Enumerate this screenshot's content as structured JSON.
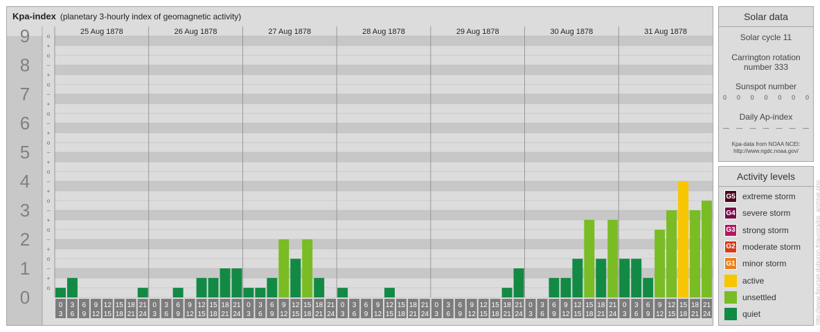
{
  "header": {
    "title": "Kpa-index",
    "subtitle": "(planetary 3-hourly index of geomagnetic activity)"
  },
  "chart_data": {
    "type": "bar",
    "ylim": [
      0,
      9
    ],
    "y_tick_labels": [
      "0",
      "1",
      "2",
      "3",
      "4",
      "5",
      "6",
      "7",
      "8",
      "9"
    ],
    "sub_labels": [
      "–",
      "o",
      "+"
    ],
    "days": [
      "25 Aug 1878",
      "26 Aug 1878",
      "27 Aug 1878",
      "28 Aug 1878",
      "29 Aug 1878",
      "30 Aug 1878",
      "31 Aug 1878"
    ],
    "interval_start": [
      "0",
      "3",
      "6",
      "9",
      "12",
      "15",
      "18",
      "21"
    ],
    "interval_end": [
      "3",
      "6",
      "9",
      "12",
      "15",
      "18",
      "21",
      "24"
    ],
    "values": [
      0.33,
      0.67,
      0,
      0,
      0,
      0,
      0,
      0.33,
      0,
      0,
      0.33,
      0,
      0.67,
      0.67,
      1,
      1,
      0.33,
      0.33,
      0.67,
      2,
      1.33,
      2,
      0.67,
      0,
      0.33,
      0,
      0,
      0,
      0.33,
      0,
      0,
      0,
      0,
      0,
      0,
      0,
      0,
      0,
      0.33,
      1,
      0,
      0,
      0.67,
      0.67,
      1.33,
      2.67,
      1.33,
      2.67,
      1.33,
      1.33,
      0.67,
      2.33,
      3,
      4,
      3,
      3.33
    ],
    "level_colors": {
      "quiet": "#128a44",
      "unsettled": "#79bc24",
      "active": "#f8c600"
    }
  },
  "solar": {
    "title": "Solar data",
    "cycle": "Solar cycle 11",
    "carrington_line1": "Carrington rotation",
    "carrington_line2": "number 333",
    "sunspot_label": "Sunspot number",
    "sunspot_values": [
      "0",
      "0",
      "0",
      "0",
      "0",
      "0",
      "0"
    ],
    "ap_label": "Daily Ap-index",
    "ap_values": [
      "—",
      "—",
      "—",
      "—",
      "—",
      "—",
      "—"
    ],
    "source_line1": "Kpa-data from NOAA NCEI:",
    "source_line2": "http://www.ngdc.noaa.gov/"
  },
  "activity": {
    "title": "Activity levels",
    "items": [
      {
        "badge": "G5",
        "label": "extreme storm",
        "color": "#4a0820"
      },
      {
        "badge": "G4",
        "label": "severe storm",
        "color": "#7a0a4a"
      },
      {
        "badge": "G3",
        "label": "strong storm",
        "color": "#b01862"
      },
      {
        "badge": "G2",
        "label": "moderate storm",
        "color": "#d83a1a"
      },
      {
        "badge": "G1",
        "label": "minor storm",
        "color": "#e8801a"
      },
      {
        "badge": "",
        "label": "active",
        "color": "#f8c600"
      },
      {
        "badge": "",
        "label": "unsettled",
        "color": "#79bc24"
      },
      {
        "badge": "",
        "label": "quiet",
        "color": "#128a44"
      }
    ]
  },
  "watermark": "http://www.fleurset-duburon.fr/aurora/kp_archive.php"
}
